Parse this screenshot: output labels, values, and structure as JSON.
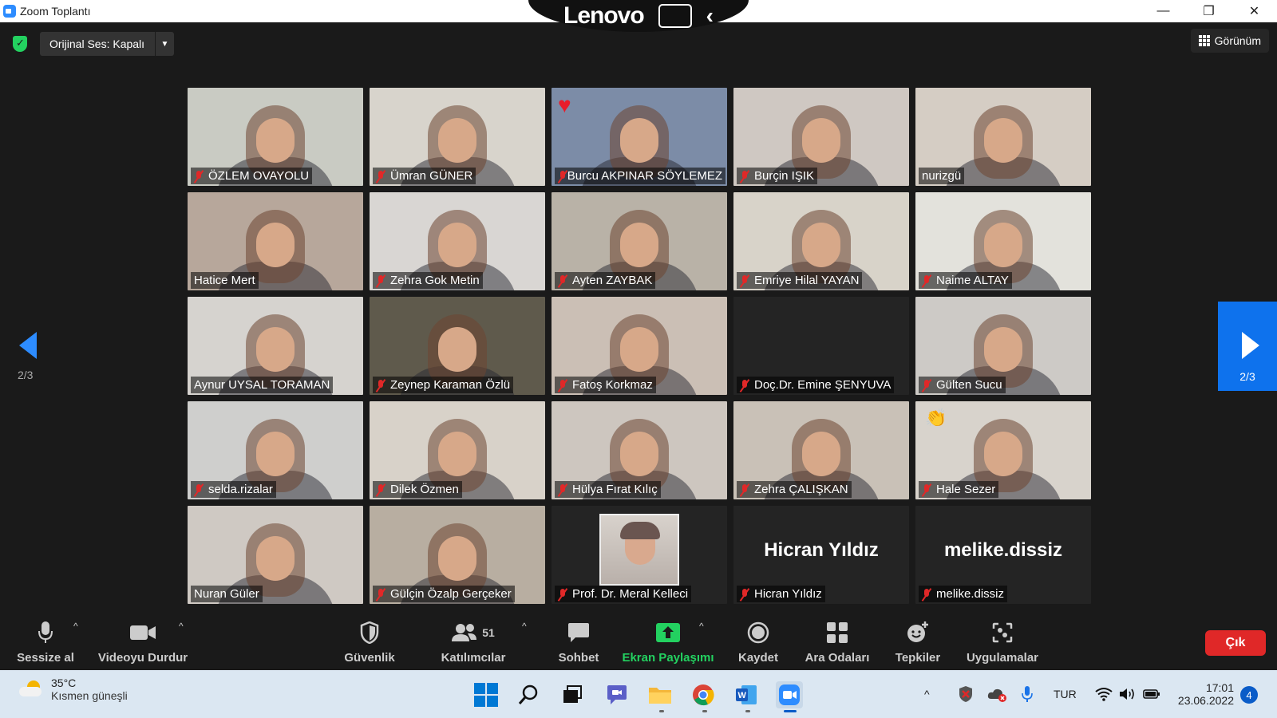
{
  "window": {
    "title": "Zoom Toplantı",
    "controls": [
      "—",
      "❐",
      "✕"
    ]
  },
  "overlay": {
    "brand": "Lenovo"
  },
  "topbar": {
    "audio_label": "Orijinal Ses: Kapalı",
    "view_label": "Görünüm"
  },
  "pagination": {
    "left_label": "2/3",
    "right_label": "2/3"
  },
  "participants": [
    {
      "name": "ÖZLEM OVAYOLU",
      "muted": true,
      "bg": "#c9cbc3"
    },
    {
      "name": "Ümran GÜNER",
      "muted": true,
      "bg": "#d8d4cc"
    },
    {
      "name": "Burcu AKPINAR SÖYLEMEZ",
      "muted": true,
      "bg": "#7c8ca7",
      "reaction": "heart"
    },
    {
      "name": "Burçin IŞIK",
      "muted": true,
      "bg": "#cfc8c2"
    },
    {
      "name": "nurizgü",
      "muted": false,
      "bg": "#d5cdc4"
    },
    {
      "name": "Hatice Mert",
      "muted": false,
      "bg": "#b7a79b"
    },
    {
      "name": "Zehra Gok Metin",
      "muted": true,
      "bg": "#d9d6d3"
    },
    {
      "name": "Ayten ZAYBAK",
      "muted": true,
      "bg": "#b9b2a7"
    },
    {
      "name": "Emriye Hilal YAYAN",
      "muted": true,
      "bg": "#d8d3c9"
    },
    {
      "name": "Naime ALTAY",
      "muted": true,
      "bg": "#e3e2dc"
    },
    {
      "name": "Aynur UYSAL TORAMAN",
      "muted": false,
      "bg": "#d6d3cf"
    },
    {
      "name": "Zeynep Karaman Özlü",
      "muted": true,
      "bg": "#5f5a4c"
    },
    {
      "name": "Fatoş Korkmaz",
      "muted": true,
      "bg": "#cbbfb5"
    },
    {
      "name": "Doç.Dr. Emine ŞENYUVA",
      "muted": true,
      "bg": "#242424",
      "video": false
    },
    {
      "name": "Gülten Sucu",
      "muted": true,
      "bg": "#cdcac6"
    },
    {
      "name": "selda.rizalar",
      "muted": true,
      "bg": "#cfcfcd"
    },
    {
      "name": "Dilek Özmen",
      "muted": true,
      "bg": "#d8d2c9"
    },
    {
      "name": "Hülya Fırat Kılıç",
      "muted": true,
      "bg": "#cdc6bf"
    },
    {
      "name": "Zehra ÇALIŞKAN",
      "muted": true,
      "bg": "#c9c1b7"
    },
    {
      "name": "Hale Sezer",
      "muted": true,
      "bg": "#d8d3cc",
      "reaction": "clap"
    },
    {
      "name": "Nuran Güler",
      "muted": false,
      "bg": "#cfc9c3"
    },
    {
      "name": "Gülçin Özalp Gerçeker",
      "muted": true,
      "bg": "#b8aea1"
    },
    {
      "name": "Prof. Dr. Meral Kelleci",
      "muted": true,
      "bg": "#242424",
      "photo": true
    },
    {
      "name": "Hicran Yıldız",
      "muted": true,
      "bg": "#242424",
      "video": false,
      "display_name": "Hicran Yıldız"
    },
    {
      "name": "melike.dissiz",
      "muted": true,
      "bg": "#242424",
      "video": false,
      "display_name": "melike.dissiz"
    }
  ],
  "toolbar": {
    "mute": "Sessize al",
    "video": "Videoyu Durdur",
    "security": "Güvenlik",
    "participants": "Katılımcılar",
    "participants_count": "51",
    "chat": "Sohbet",
    "share": "Ekran Paylaşımı",
    "record": "Kaydet",
    "breakout": "Ara Odaları",
    "reactions": "Tepkiler",
    "apps": "Uygulamalar",
    "leave": "Çık",
    "share_color": "#23d160",
    "leave_color": "#e02828"
  },
  "taskbar": {
    "temperature": "35°C",
    "weather": "Kısmen güneşli",
    "language": "TUR",
    "time": "17:01",
    "date": "23.06.2022",
    "notifications": "4"
  }
}
